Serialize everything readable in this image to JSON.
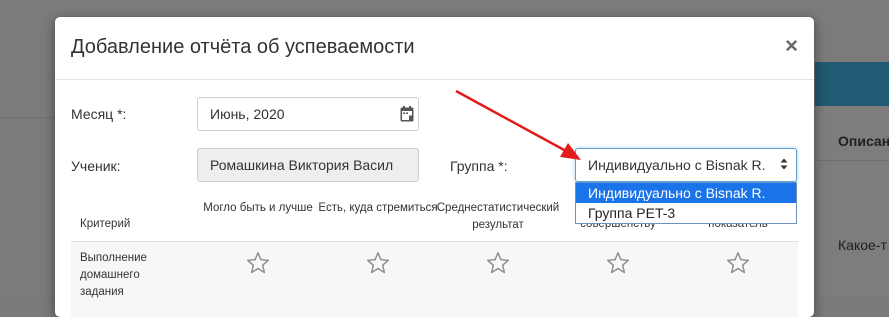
{
  "background": {
    "table_header": "Описан",
    "table_cell": "Какое-т"
  },
  "modal": {
    "title": "Добавление отчёта об успеваемости",
    "close_label": "×"
  },
  "form": {
    "month_label": "Месяц *:",
    "month_value": "Июнь, 2020",
    "student_label": "Ученик:",
    "student_value": "Ромашкина Виктория Васил",
    "group_label": "Группа *:",
    "group_value": "Индивидуально с Bisnak R.",
    "group_options": [
      "Индивидуально с Bisnak R.",
      "Группа PET-3"
    ]
  },
  "table": {
    "col_criterion": "Критерий",
    "cols": [
      "Могло быть и лучше",
      "Есть, куда стремиться",
      "Среднестатистический результат",
      "совершенству",
      "показатель"
    ],
    "rows": [
      {
        "label": "Выполнение домашнего задания"
      }
    ]
  },
  "colors": {
    "arrow": "#e31b1b",
    "selected_option": "#1a73e8"
  },
  "icons": [
    "calendar-icon",
    "chevron-updown-icon",
    "star-outline-icon",
    "close-icon"
  ]
}
